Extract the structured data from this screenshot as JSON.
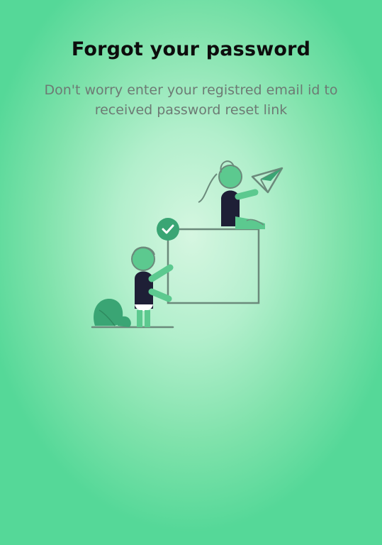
{
  "page": {
    "title": "Forgot your password",
    "subtitle": "Don't worry enter your registred email id to received password reset link"
  },
  "illustration": {
    "icons": [
      "check-icon",
      "paper-plane-icon",
      "plant-icon"
    ]
  },
  "colors": {
    "background_center": "#d4f6e0",
    "background_edge": "#55d898",
    "title": "#0d0d0d",
    "subtitle": "#6d7a74",
    "accent": "#3aa574",
    "figure_green": "#5cc98f",
    "figure_dark": "#1e1f36",
    "line": "#6b8a7b"
  }
}
